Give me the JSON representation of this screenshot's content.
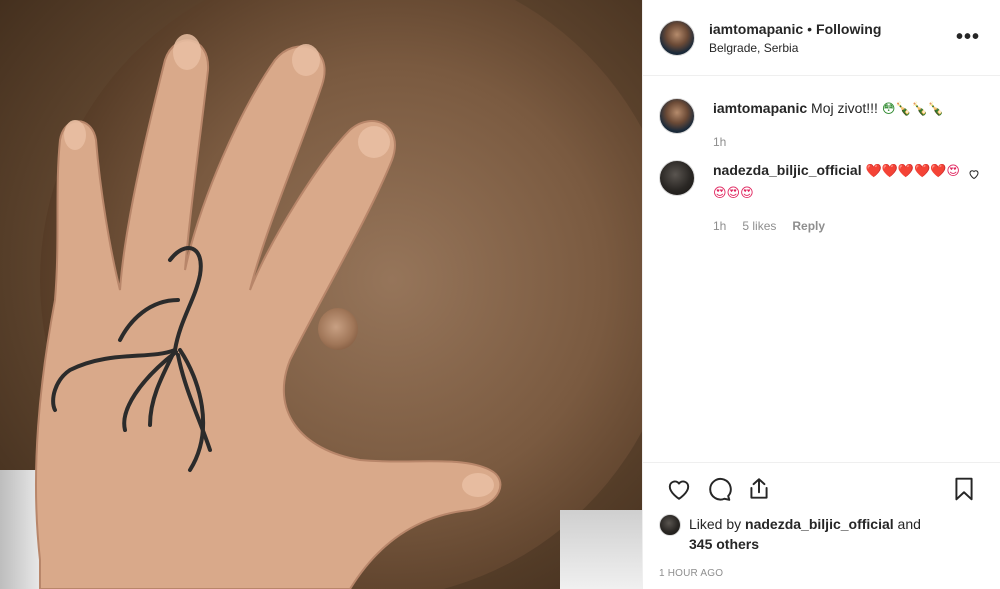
{
  "post": {
    "author": "iamtomapanic",
    "follow_separator": "•",
    "follow_status": "Following",
    "location": "Belgrade, Serbia",
    "more_icon": "more-options-icon",
    "more_label": "•••"
  },
  "comments": [
    {
      "user": "iamtomapanic",
      "text": "Moj zivot!!!",
      "emoji": "😳🍾🍾🍾",
      "age": "1h"
    },
    {
      "user": "nadezda_biljic_official",
      "text": "",
      "emoji": "❤️❤️❤️❤️❤️😍😍😍😍",
      "age": "1h",
      "likes": "5 likes",
      "reply": "Reply"
    }
  ],
  "actions": {
    "like_icon": "heart-icon",
    "comment_icon": "comment-icon",
    "share_icon": "share-icon",
    "save_icon": "bookmark-icon"
  },
  "liked_by": {
    "prefix": "Liked by",
    "user": "nadezda_biljic_official",
    "and": "and",
    "others": "345 others"
  },
  "timestamp": "1 HOUR AGO"
}
